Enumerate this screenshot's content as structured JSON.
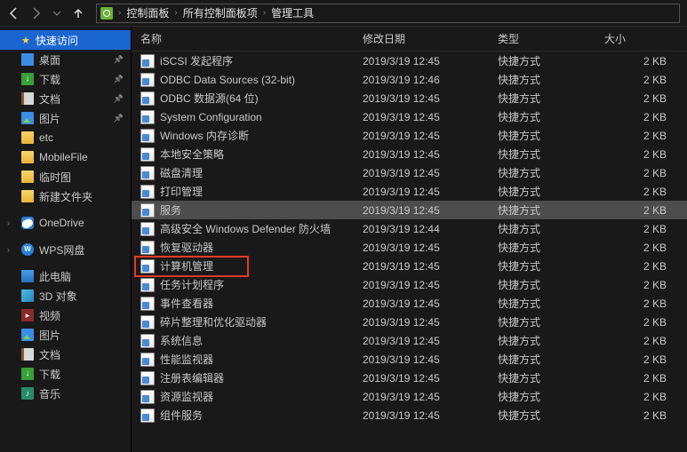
{
  "breadcrumbs": [
    "控制面板",
    "所有控制面板项",
    "管理工具"
  ],
  "columns": {
    "name": "名称",
    "date": "修改日期",
    "type": "类型",
    "size": "大小"
  },
  "sidebar": {
    "quick_access": "快速访问",
    "items": [
      {
        "label": "桌面",
        "icon": "ic-desktop",
        "pinned": true
      },
      {
        "label": "下载",
        "icon": "ic-download",
        "pinned": true
      },
      {
        "label": "文档",
        "icon": "ic-doc",
        "pinned": true
      },
      {
        "label": "图片",
        "icon": "ic-pic",
        "pinned": true
      },
      {
        "label": "etc",
        "icon": "ic-folder",
        "pinned": false
      },
      {
        "label": "MobileFile",
        "icon": "ic-folder",
        "pinned": false
      },
      {
        "label": "临时图",
        "icon": "ic-folder",
        "pinned": false
      },
      {
        "label": "新建文件夹",
        "icon": "ic-folder",
        "pinned": false
      }
    ],
    "onedrive": "OneDrive",
    "wps": "WPS网盘",
    "this_pc": "此电脑",
    "pc_items": [
      {
        "label": "3D 对象",
        "icon": "ic-3d"
      },
      {
        "label": "视频",
        "icon": "ic-video"
      },
      {
        "label": "图片",
        "icon": "ic-pic"
      },
      {
        "label": "文档",
        "icon": "ic-doc"
      },
      {
        "label": "下载",
        "icon": "ic-download"
      },
      {
        "label": "音乐",
        "icon": "ic-music"
      }
    ]
  },
  "rows": [
    {
      "name": "iSCSI 发起程序",
      "date": "2019/3/19 12:45",
      "type": "快捷方式",
      "size": "2 KB"
    },
    {
      "name": "ODBC Data Sources (32-bit)",
      "date": "2019/3/19 12:46",
      "type": "快捷方式",
      "size": "2 KB"
    },
    {
      "name": "ODBC 数据源(64 位)",
      "date": "2019/3/19 12:45",
      "type": "快捷方式",
      "size": "2 KB"
    },
    {
      "name": "System Configuration",
      "date": "2019/3/19 12:45",
      "type": "快捷方式",
      "size": "2 KB"
    },
    {
      "name": "Windows 内存诊断",
      "date": "2019/3/19 12:45",
      "type": "快捷方式",
      "size": "2 KB"
    },
    {
      "name": "本地安全策略",
      "date": "2019/3/19 12:45",
      "type": "快捷方式",
      "size": "2 KB"
    },
    {
      "name": "磁盘清理",
      "date": "2019/3/19 12:45",
      "type": "快捷方式",
      "size": "2 KB"
    },
    {
      "name": "打印管理",
      "date": "2019/3/19 12:45",
      "type": "快捷方式",
      "size": "2 KB"
    },
    {
      "name": "服务",
      "date": "2019/3/19 12:45",
      "type": "快捷方式",
      "size": "2 KB",
      "selected": true
    },
    {
      "name": "高级安全 Windows Defender 防火墙",
      "date": "2019/3/19 12:44",
      "type": "快捷方式",
      "size": "2 KB"
    },
    {
      "name": "恢复驱动器",
      "date": "2019/3/19 12:45",
      "type": "快捷方式",
      "size": "2 KB"
    },
    {
      "name": "计算机管理",
      "date": "2019/3/19 12:45",
      "type": "快捷方式",
      "size": "2 KB",
      "highlight": true
    },
    {
      "name": "任务计划程序",
      "date": "2019/3/19 12:45",
      "type": "快捷方式",
      "size": "2 KB"
    },
    {
      "name": "事件查看器",
      "date": "2019/3/19 12:45",
      "type": "快捷方式",
      "size": "2 KB"
    },
    {
      "name": "碎片整理和优化驱动器",
      "date": "2019/3/19 12:45",
      "type": "快捷方式",
      "size": "2 KB"
    },
    {
      "name": "系统信息",
      "date": "2019/3/19 12:45",
      "type": "快捷方式",
      "size": "2 KB"
    },
    {
      "name": "性能监视器",
      "date": "2019/3/19 12:45",
      "type": "快捷方式",
      "size": "2 KB"
    },
    {
      "name": "注册表编辑器",
      "date": "2019/3/19 12:45",
      "type": "快捷方式",
      "size": "2 KB"
    },
    {
      "name": "资源监视器",
      "date": "2019/3/19 12:45",
      "type": "快捷方式",
      "size": "2 KB"
    },
    {
      "name": "组件服务",
      "date": "2019/3/19 12:45",
      "type": "快捷方式",
      "size": "2 KB"
    }
  ]
}
